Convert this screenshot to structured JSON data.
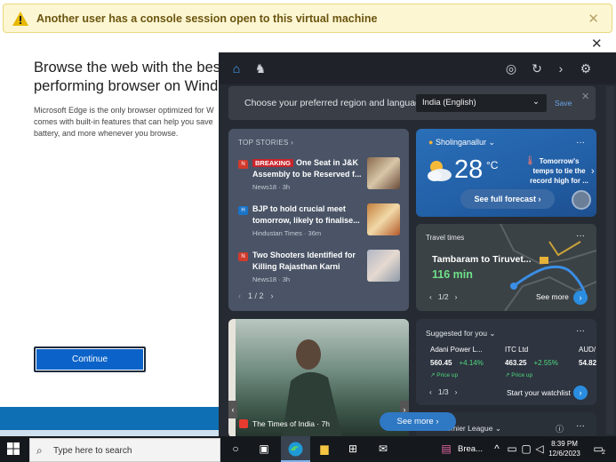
{
  "warning": {
    "text": "Another user has a console session open to this virtual machine",
    "close": "✕"
  },
  "page": {
    "close": "✕"
  },
  "edge": {
    "title_line1": "Browse the web with the bes",
    "title_line2": "performing browser on Wind",
    "desc_line1": "Microsoft Edge is the only browser optimized for W",
    "desc_line2": "comes with built-in features that can help you save",
    "desc_line3": "battery, and more whenever you browse.",
    "continue": "Continue"
  },
  "widgets": {
    "region": {
      "label": "Choose your preferred region and language.",
      "selected": "India (English)",
      "save": "Save",
      "close": "✕"
    },
    "top_stories": {
      "heading": "TOP STORIES ›",
      "items": [
        {
          "badge": "BREAKING",
          "title": "One Seat in J&K Assembly to be Reserved f...",
          "source": "News18 · 3h"
        },
        {
          "badge": "",
          "title": "BJP to hold crucial meet tomorrow, likely to finalise...",
          "source": "Hindustan Times · 36m"
        },
        {
          "badge": "",
          "title": "Two Shooters Identified for Killing Rajasthan Karni Sen...",
          "source": "News18 · 3h"
        }
      ],
      "pager": "1 / 2"
    },
    "weather": {
      "location": "Sholinganallur",
      "temp": "28",
      "unit": "°C",
      "note": "Tomorrow's temps to tie the record high for ...",
      "forecast_button": "See full forecast ›",
      "more": "···"
    },
    "travel": {
      "label": "Travel times",
      "route": "Tambaram to Tiruvet...",
      "time": "116 min",
      "see_more": "See more",
      "pager": "1/2",
      "more": "···"
    },
    "photo": {
      "source": "The Times of India · 7h"
    },
    "see_more": "See more ›",
    "suggested": {
      "title": "Suggested for you ⌄",
      "stocks": [
        {
          "name": "Adani Power L...",
          "price": "560.45",
          "change": "+4.14%",
          "tag": "Price up"
        },
        {
          "name": "ITC Ltd",
          "price": "463.25",
          "change": "+2.55%",
          "tag": "Price up"
        },
        {
          "name": "AUD/",
          "price": "54.82",
          "change": "",
          "tag": ""
        }
      ],
      "pager": "1/3",
      "watchlist": "Start your watchlist",
      "more": "···"
    },
    "league": {
      "text": "Premier League ⌄",
      "more": "···"
    }
  },
  "taskbar": {
    "search_placeholder": "Type here to search",
    "app_label": "Brea...",
    "time": "8:39 PM",
    "date": "12/6/2023",
    "notification_count": "2"
  },
  "colors": {
    "accent": "#0b63c9",
    "panel": "#262b33",
    "positive": "#4fd97b",
    "warning_bg": "#fdf6d3"
  }
}
